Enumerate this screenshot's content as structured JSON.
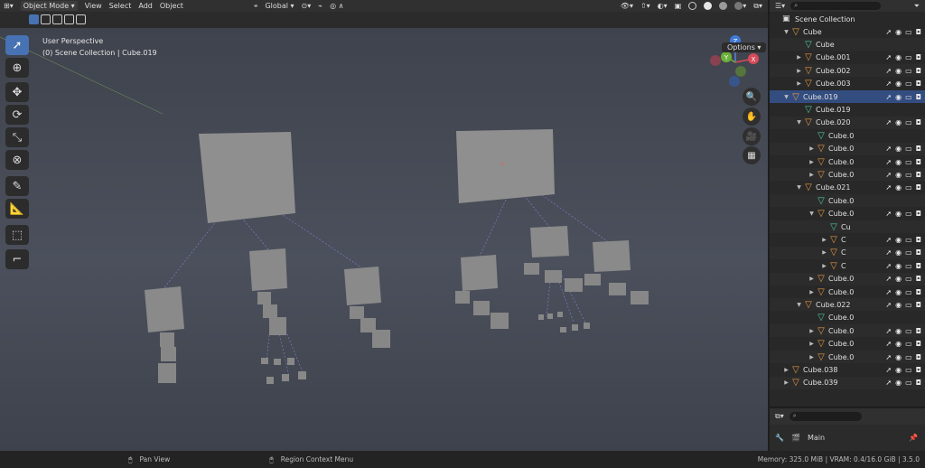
{
  "header": {
    "mode": "Object Mode",
    "menus": [
      "View",
      "Select",
      "Add",
      "Object"
    ],
    "orientation": "Global"
  },
  "viewport": {
    "title": "User Perspective",
    "subtitle": "(0) Scene Collection | Cube.019",
    "options_label": "Options",
    "gizmo_axes": [
      "Z",
      "Y",
      "X"
    ]
  },
  "outliner": {
    "root": "Scene Collection",
    "rows": [
      {
        "label": "Cube",
        "kind": "coll",
        "indent": 0,
        "tri": "▾"
      },
      {
        "label": "Cube",
        "kind": "mesh",
        "indent": 1,
        "tri": ""
      },
      {
        "label": "Cube.001",
        "kind": "coll",
        "indent": 1,
        "tri": "▸"
      },
      {
        "label": "Cube.002",
        "kind": "coll",
        "indent": 1,
        "tri": "▸"
      },
      {
        "label": "Cube.003",
        "kind": "coll",
        "indent": 1,
        "tri": "▸"
      },
      {
        "label": "Cube.019",
        "kind": "coll",
        "indent": 0,
        "tri": "▾",
        "selected": true
      },
      {
        "label": "Cube.019",
        "kind": "mesh",
        "indent": 1,
        "tri": ""
      },
      {
        "label": "Cube.020",
        "kind": "coll",
        "indent": 1,
        "tri": "▾"
      },
      {
        "label": "Cube.0",
        "kind": "mesh",
        "indent": 2,
        "tri": ""
      },
      {
        "label": "Cube.0",
        "kind": "coll",
        "indent": 2,
        "tri": "▸"
      },
      {
        "label": "Cube.0",
        "kind": "coll",
        "indent": 2,
        "tri": "▸"
      },
      {
        "label": "Cube.0",
        "kind": "coll",
        "indent": 2,
        "tri": "▸"
      },
      {
        "label": "Cube.021",
        "kind": "coll",
        "indent": 1,
        "tri": "▾"
      },
      {
        "label": "Cube.0",
        "kind": "mesh",
        "indent": 2,
        "tri": ""
      },
      {
        "label": "Cube.0",
        "kind": "coll",
        "indent": 2,
        "tri": "▾"
      },
      {
        "label": "Cu",
        "kind": "mesh",
        "indent": 3,
        "tri": ""
      },
      {
        "label": "C",
        "kind": "coll",
        "indent": 3,
        "tri": "▸"
      },
      {
        "label": "C",
        "kind": "coll",
        "indent": 3,
        "tri": "▸"
      },
      {
        "label": "C",
        "kind": "coll",
        "indent": 3,
        "tri": "▸"
      },
      {
        "label": "Cube.0",
        "kind": "coll",
        "indent": 2,
        "tri": "▸"
      },
      {
        "label": "Cube.0",
        "kind": "coll",
        "indent": 2,
        "tri": "▸"
      },
      {
        "label": "Cube.022",
        "kind": "coll",
        "indent": 1,
        "tri": "▾"
      },
      {
        "label": "Cube.0",
        "kind": "mesh",
        "indent": 2,
        "tri": ""
      },
      {
        "label": "Cube.0",
        "kind": "coll",
        "indent": 2,
        "tri": "▸"
      },
      {
        "label": "Cube.0",
        "kind": "coll",
        "indent": 2,
        "tri": "▸"
      },
      {
        "label": "Cube.0",
        "kind": "coll",
        "indent": 2,
        "tri": "▸"
      },
      {
        "label": "Cube.038",
        "kind": "coll",
        "indent": 0,
        "tri": "▸"
      },
      {
        "label": "Cube.039",
        "kind": "coll",
        "indent": 0,
        "tri": "▸"
      }
    ]
  },
  "properties": {
    "scene_label": "Main"
  },
  "statusbar": {
    "left": "Pan View",
    "mid": "Region Context Menu",
    "right": "Memory: 325.0 MiB | VRAM: 0.4/16.0 GiB | 3.5.0"
  },
  "colors": {
    "accent": "#4772b3",
    "collection": "#e89a42",
    "mesh": "#4fc7a3",
    "selection": "#334d80"
  }
}
